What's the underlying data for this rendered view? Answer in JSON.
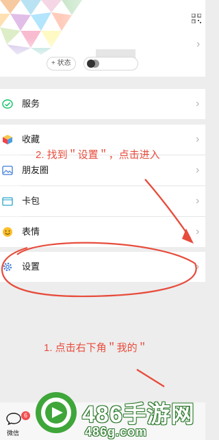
{
  "profile": {
    "status_label": "+ 状态",
    "chevron": "›"
  },
  "menu": {
    "items": [
      {
        "label": "服务",
        "icon": "service-icon"
      },
      {
        "label": "收藏",
        "icon": "favorites-cube-icon"
      },
      {
        "label": "朋友圈",
        "icon": "moments-photo-icon"
      },
      {
        "label": "卡包",
        "icon": "card-wallet-icon"
      },
      {
        "label": "表情",
        "icon": "sticker-smiley-icon"
      },
      {
        "label": "设置",
        "icon": "settings-gear-icon"
      }
    ],
    "chevron": "›"
  },
  "annotations": {
    "step2": "2. 找到＂设置＂，点击进入",
    "step1": "1. 点击右下角＂我的＂"
  },
  "tabbar": {
    "chat_label": "微信",
    "chat_badge": "6"
  },
  "watermark": {
    "title": "486手游网",
    "url": "486g.com"
  },
  "colors": {
    "annotation_red": "#e74c3c",
    "wechat_green": "#07c160",
    "background": "#ededed"
  }
}
